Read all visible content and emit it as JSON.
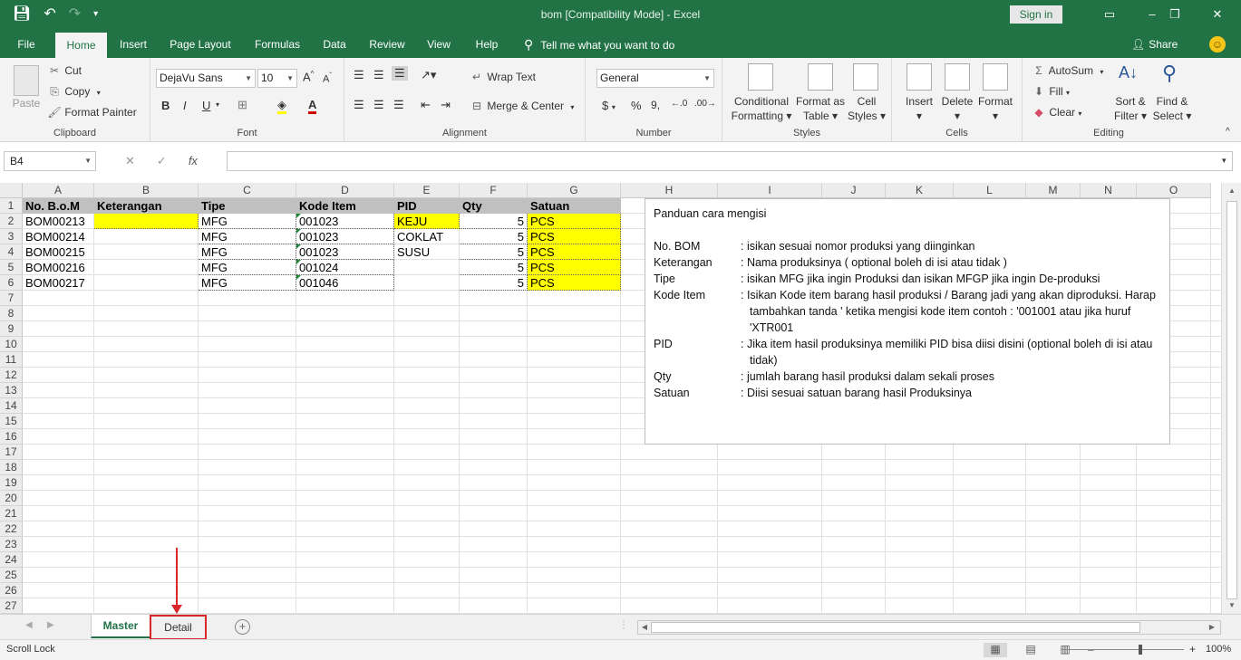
{
  "window": {
    "title": "bom  [Compatibility Mode]  -  Excel",
    "sign_in": "Sign in",
    "share": "Share",
    "tell_me": "Tell me what you want to do",
    "accent": "#217346"
  },
  "ribbon_tabs": [
    "File",
    "Home",
    "Insert",
    "Page Layout",
    "Formulas",
    "Data",
    "Review",
    "View",
    "Help"
  ],
  "ribbon": {
    "clipboard": {
      "paste": "Paste",
      "cut": "Cut",
      "copy": "Copy",
      "format_painter": "Format Painter",
      "label": "Clipboard"
    },
    "font": {
      "name": "DejaVu Sans",
      "size": "10",
      "label": "Font",
      "bold": "B",
      "italic": "I",
      "underline": "U",
      "font_color_glyph": "A",
      "grow_glyph": "A",
      "shrink_glyph": "A"
    },
    "alignment": {
      "wrap_text": "Wrap Text",
      "merge_center": "Merge & Center",
      "label": "Alignment"
    },
    "number": {
      "format": "General",
      "currency_glyph": "$",
      "percent_glyph": "%",
      "comma_glyph": "9",
      "label": "Number"
    },
    "styles": {
      "conditional_1": "Conditional",
      "conditional_2": "Formatting",
      "format_table_1": "Format as",
      "format_table_2": "Table",
      "cell_styles_1": "Cell",
      "cell_styles_2": "Styles",
      "label": "Styles"
    },
    "cells": {
      "insert": "Insert",
      "delete": "Delete",
      "format": "Format",
      "label": "Cells"
    },
    "editing": {
      "autosum": "AutoSum",
      "fill": "Fill",
      "clear": "Clear",
      "sort_1": "Sort &",
      "sort_2": "Filter",
      "find_1": "Find &",
      "find_2": "Select",
      "label": "Editing"
    }
  },
  "formula_bar": {
    "name_box": "B4",
    "cancel": "✕",
    "enter": "✓",
    "fx": "fx",
    "content": ""
  },
  "columns": [
    "A",
    "B",
    "C",
    "D",
    "E",
    "F",
    "G",
    "H",
    "I",
    "J",
    "K",
    "L",
    "M",
    "N",
    "O"
  ],
  "rows": [
    "1",
    "2",
    "3",
    "4",
    "5",
    "6",
    "7",
    "8",
    "9",
    "10",
    "11",
    "12",
    "13",
    "14",
    "15",
    "16",
    "17",
    "18",
    "19",
    "20",
    "21",
    "22",
    "23",
    "24",
    "25",
    "26",
    "27"
  ],
  "table": {
    "headers": [
      "No. B.o.M",
      "Keterangan",
      "Tipe",
      "Kode Item",
      "PID",
      "Qty",
      "Satuan"
    ],
    "rows": [
      [
        "BOM00213",
        "",
        "MFG",
        "001023",
        "KEJU",
        "5",
        "PCS"
      ],
      [
        "BOM00214",
        "",
        "MFG",
        "001023",
        "COKLAT",
        "5",
        "PCS"
      ],
      [
        "BOM00215",
        "",
        "MFG",
        "001023",
        "SUSU",
        "5",
        "PCS"
      ],
      [
        "BOM00216",
        "",
        "MFG",
        "001024",
        "",
        "5",
        "PCS"
      ],
      [
        "BOM00217",
        "",
        "MFG",
        "001046",
        "",
        "5",
        "PCS"
      ]
    ]
  },
  "guide": {
    "title": "Panduan cara mengisi",
    "items": [
      {
        "key": "No. BOM",
        "value": ": isikan sesuai nomor produksi yang diinginkan"
      },
      {
        "key": "Keterangan",
        "value": ": Nama produksinya ( optional boleh di isi atau tidak )"
      },
      {
        "key": "Tipe",
        "value": ": isikan MFG jika ingin Produksi dan isikan MFGP jika ingin De-produksi"
      },
      {
        "key": "Kode Item",
        "value": ": Isikan Kode item barang hasil produksi / Barang jadi yang akan diproduksi. Harap tambahkan tanda ' ketika mengisi kode item contoh : '001001 atau jika huruf 'XTR001"
      },
      {
        "key": "PID",
        "value": ": Jika item hasil produksinya memiliki PID bisa diisi disini (optional boleh di isi atau tidak)"
      },
      {
        "key": "Qty",
        "value": ": jumlah barang hasil produksi dalam sekali proses"
      },
      {
        "key": "Satuan",
        "value": ": Diisi sesuai satuan barang hasil Produksinya"
      }
    ]
  },
  "sheets": {
    "active": "Master",
    "other": "Detail",
    "add": "+"
  },
  "status": {
    "left": "Scroll Lock",
    "zoom": "100%"
  },
  "colors": {
    "header_fill": "#c0c0c0",
    "highlight": "#ffff00",
    "annotation": "#d9262c"
  }
}
